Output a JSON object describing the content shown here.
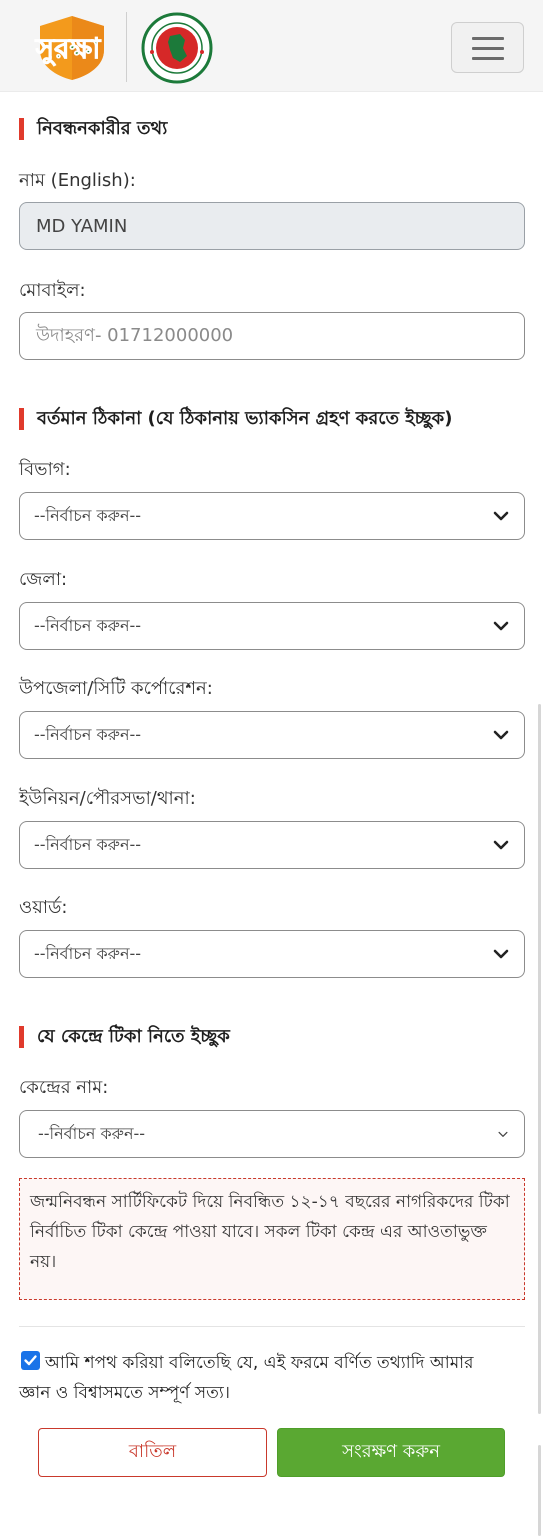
{
  "header": {
    "logo_text": "সুরক্ষা",
    "seal_text": "গণপ্রজাতন্ত্রী বাংলাদেশ সরকার"
  },
  "sections": {
    "registrant_info": "নিবন্ধনকারীর তথ্য",
    "current_address": "বর্তমান ঠিকানা (যে ঠিকানায় ভ্যাকসিন গ্রহণ করতে ইচ্ছুক)",
    "center": "যে কেন্দ্রে টিকা নিতে ইচ্ছুক"
  },
  "fields": {
    "name_label": "নাম (English):",
    "name_value": "MD YAMIN",
    "mobile_label": "মোবাইল:",
    "mobile_placeholder": "উদাহরণ- 01712000000"
  },
  "address": {
    "division_label": "বিভাগ:",
    "district_label": "জেলা:",
    "upazila_label": "উপজেলা/সিটি কর্পোরেশন:",
    "union_label": "ইউনিয়ন/পৌরসভা/থানা:",
    "ward_label": "ওয়ার্ড:",
    "select_placeholder": "--নির্বাচন করুন--"
  },
  "center": {
    "name_label": "কেন্দ্রের নাম:",
    "select_placeholder": "--নির্বাচন করুন--"
  },
  "notice": "জন্মনিবন্ধন সার্টিফিকেট দিয়ে নিবন্ধিত ১২-১৭ বছরের নাগরিকদের টিকা নির্বাচিত টিকা কেন্দ্রে পাওয়া যাবে। সকল টিকা কেন্দ্র এর আওতাভুক্ত নয়।",
  "oath": {
    "line1": "আমি শপথ করিয়া বলিতেছি যে, এই ফরমে বর্ণিত তথ্যাদি আমার",
    "line2": "জ্ঞান ও বিশ্বাসমতে সম্পূর্ণ সত্য।",
    "checked": true
  },
  "buttons": {
    "cancel": "বাতিল",
    "save": "সংরক্ষণ করুন"
  },
  "colors": {
    "accent_red": "#e03a2c",
    "save_green": "#5aa832",
    "checkbox_blue": "#1a73e8",
    "logo_orange": "#f39a1c",
    "logo_green": "#2e8b3a"
  }
}
